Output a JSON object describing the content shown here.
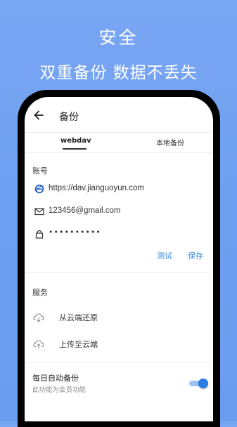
{
  "headline": {
    "line1": "安全",
    "line2": "双重备份 数据不丢失"
  },
  "appbar": {
    "title": "备份",
    "back_icon": "arrow-left-icon"
  },
  "tabs": [
    {
      "label": "webdav",
      "active": true
    },
    {
      "label": "本地备份",
      "active": false
    }
  ],
  "account": {
    "section_label": "账号",
    "server_url": "https://dav.jianguoyun.com",
    "email": "123456@gmail.com",
    "password_masked": "••••••••••",
    "test_label": "测试",
    "save_label": "保存"
  },
  "service": {
    "section_label": "服务",
    "items": [
      {
        "label": "从云端还原",
        "icon": "cloud-download-icon"
      },
      {
        "label": "上传至云端",
        "icon": "cloud-upload-icon"
      }
    ]
  },
  "auto_backup": {
    "title": "每日自动备份",
    "subtitle": "此功能为会员功能",
    "enabled": true
  },
  "colors": {
    "background": "#79a6f3",
    "accent": "#3b8be6",
    "toggle_on": "#2b7de1"
  }
}
